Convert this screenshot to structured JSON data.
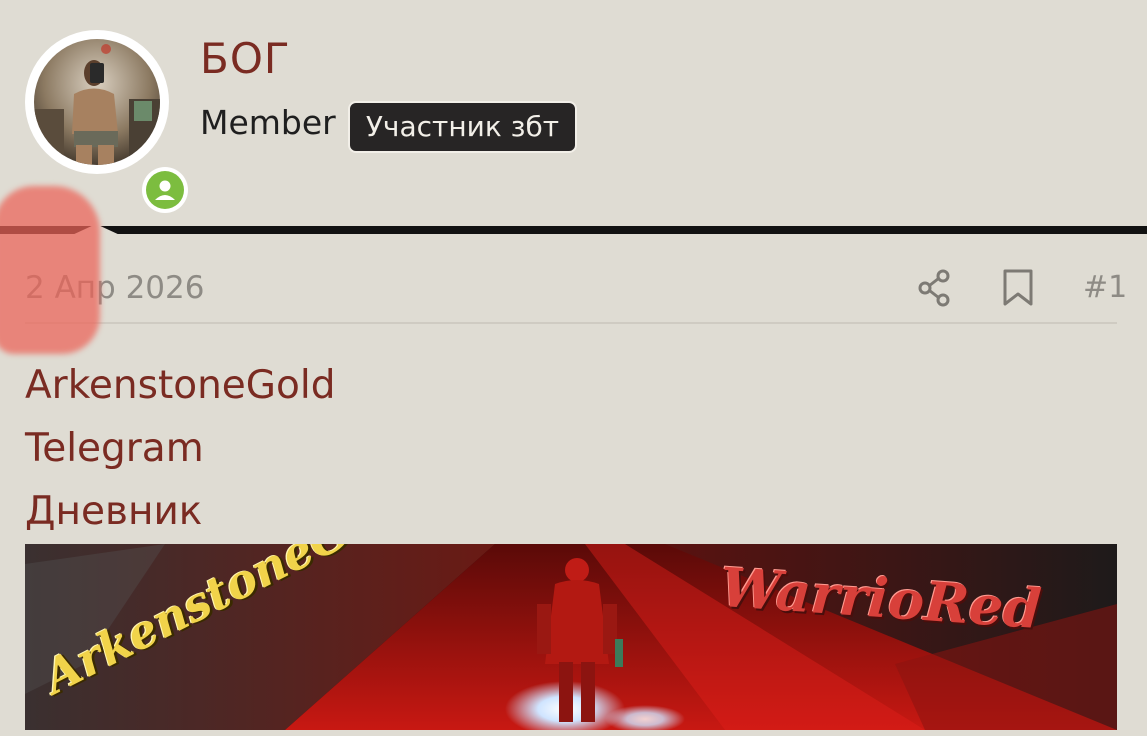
{
  "profile": {
    "username": "БОГ",
    "user_title": "Member",
    "user_banner": "Участник збт",
    "avatar_icon": "user-avatar-photo",
    "online_icon": "user-online-icon",
    "online_color": "#7cbd3f"
  },
  "post": {
    "date": "2 Апр 2026",
    "number": "#1",
    "share_icon": "share-icon",
    "bookmark_icon": "bookmark-icon"
  },
  "signature": {
    "links": [
      "ArkenstoneGold",
      "Telegram",
      "Дневник"
    ],
    "banner": {
      "left_text": "ArkenstoneGold",
      "right_text": "WarrioRed"
    }
  },
  "colors": {
    "background": "#dfdcd3",
    "accent": "#7a2b22",
    "muted": "#8e8b85",
    "banner_bg": "#272525"
  }
}
